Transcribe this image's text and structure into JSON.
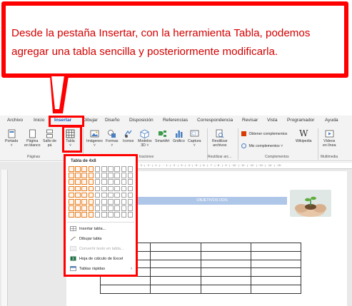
{
  "callout": {
    "line1": "Desde la pestaña Insertar, con la herramienta Tabla, podemos",
    "line2": "agregar una tabla sencilla y posteriormente modificarla."
  },
  "tabs": [
    "Archivo",
    "Inicio",
    "Insertar",
    "Dibujar",
    "Diseño",
    "Disposición",
    "Referencias",
    "Correspondencia",
    "Revisar",
    "Vista",
    "Programador",
    "Ayuda"
  ],
  "ribbon": {
    "portada": "Portada",
    "portada2": "˅",
    "pagina_blanco": "Página",
    "pagina_blanco2": "en blanco",
    "salto": "Salto de",
    "salto2": "pá",
    "tabla": "Tabla",
    "tabla2": "˅",
    "imagenes": "Imágenes",
    "imagenes2": "˅",
    "formas": "Formas",
    "formas2": "˅",
    "iconos": "Iconos",
    "modelos": "Modelos",
    "modelos2": "3D ˅",
    "smartart": "SmartArt",
    "grafico": "Gráfico",
    "captura": "Captura",
    "captura2": "˅",
    "reutilizar": "Reutilizar",
    "reutilizar2": "archivos",
    "obtener": "Obtener complementos",
    "mis": "Mis complementos",
    "mis_chev": "˅",
    "wikipedia": "Wikipedia",
    "videos": "Vídeos",
    "videos2": "en línea",
    "group_paginas": "Páginas",
    "group_ilustraciones": "traciones",
    "group_reutilizar": "Reutilizar arc...",
    "group_complementos": "Complementos",
    "group_multimedia": "Multimedia"
  },
  "ruler": "· 3 · | · 2 · | · 1 · | · · · 1 · | · 2 · | · 3 · | · 4 · | · 5 · | · 6 · | · 7 · | · 8 · | · 9 · | · 10 · | · 11 · | · 12 · | · 13 · | · 14 · | · 15 ·",
  "document": {
    "ods_title": "OBJETIVOS ODS"
  },
  "dropdown": {
    "title": "Tabla de 4x8",
    "grid_cols": 10,
    "grid_rows": 8,
    "selected_cols": 4,
    "selected_rows": 8,
    "items": [
      {
        "label": "Insertar tabla...",
        "icon": "insert-table-icon",
        "disabled": false
      },
      {
        "label": "Dibujar tabla",
        "icon": "draw-table-icon",
        "disabled": false
      },
      {
        "label": "Convertir texto en tabla...",
        "icon": "convert-text-icon",
        "disabled": true
      },
      {
        "label": "Hoja de cálculo de Excel",
        "icon": "excel-icon",
        "disabled": false
      },
      {
        "label": "Tablas rápidas",
        "icon": "quick-tables-icon",
        "disabled": false
      }
    ],
    "submenu_arrow": "›"
  },
  "colors": {
    "callout_red": "#ff0000",
    "callout_text": "#d40000",
    "accent_blue": "#185abd",
    "grid_selected": "#e67e22",
    "ods_bar": "#aec6e8"
  }
}
